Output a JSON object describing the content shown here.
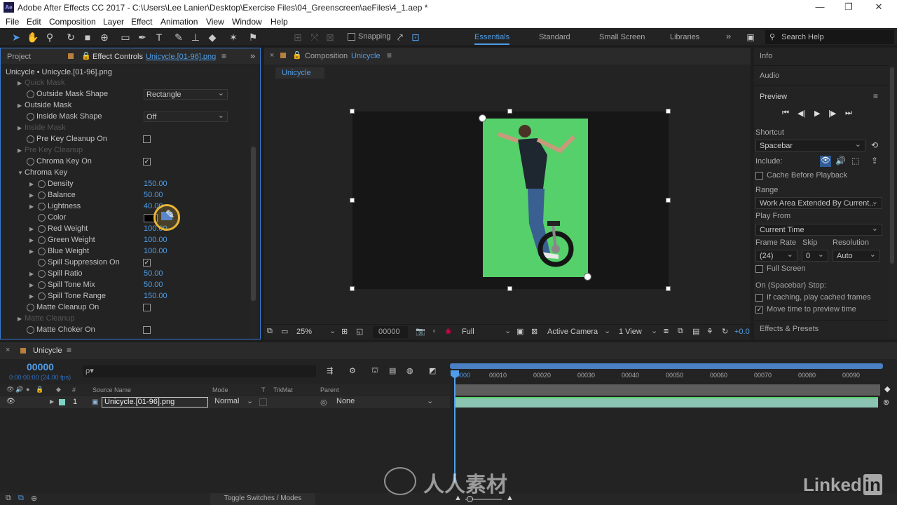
{
  "window": {
    "app_badge": "Ae",
    "title": "Adobe After Effects CC 2017 - C:\\Users\\Lee Lanier\\Desktop\\Exercise Files\\04_Greenscreen\\aeFiles\\4_1.aep *",
    "minimize": "—",
    "maximize": "❐",
    "close": "✕"
  },
  "menu": [
    "File",
    "Edit",
    "Composition",
    "Layer",
    "Effect",
    "Animation",
    "View",
    "Window",
    "Help"
  ],
  "toolbar": {
    "snapping_label": "Snapping",
    "workspaces": [
      "Essentials",
      "Standard",
      "Small Screen",
      "Libraries"
    ],
    "active_workspace": "Essentials",
    "more": "»",
    "search_placeholder": "Search Help"
  },
  "left_panel": {
    "tab_project": "Project",
    "tab_effect_controls": "Effect Controls",
    "tab_effect_controls_target": "Unicycle.[01-96].png",
    "header": "Unicycle • Unicycle.[01-96].png",
    "props": {
      "quick_mask": "Quick Mask",
      "outside_mask_shape": "Outside Mask Shape",
      "outside_mask_shape_val": "Rectangle",
      "outside_mask": "Outside Mask",
      "inside_mask_shape": "Inside Mask Shape",
      "inside_mask_shape_val": "Off",
      "inside_mask": "Inside Mask",
      "pre_key_cleanup_on": "Pre Key Cleanup On",
      "pre_key_cleanup": "Pre Key Cleanup",
      "chroma_key_on": "Chroma Key On",
      "chroma_key": "Chroma Key",
      "density": "Density",
      "density_val": "150.00",
      "balance": "Balance",
      "balance_val": "50.00",
      "lightness": "Lightness",
      "lightness_val": "40.00",
      "color": "Color",
      "red_weight": "Red Weight",
      "red_weight_val": "100.00",
      "green_weight": "Green Weight",
      "green_weight_val": "100.00",
      "blue_weight": "Blue Weight",
      "blue_weight_val": "100.00",
      "spill_suppression_on": "Spill Suppression On",
      "spill_ratio": "Spill Ratio",
      "spill_ratio_val": "50.00",
      "spill_tone_mix": "Spill Tone Mix",
      "spill_tone_mix_val": "50.00",
      "spill_tone_range": "Spill Tone Range",
      "spill_tone_range_val": "150.00",
      "matte_cleanup_on": "Matte Cleanup On",
      "matte_cleanup": "Matte Cleanup",
      "matte_choker_on": "Matte Choker On"
    }
  },
  "comp_panel": {
    "tab_prefix": "Composition",
    "tab_name": "Unicycle",
    "subtab": "Unicycle",
    "zoom": "25%",
    "timecode": "00000",
    "resolution": "Full",
    "camera": "Active Camera",
    "views": "1 View",
    "exposure": "+0.0"
  },
  "right_panel": {
    "info": "Info",
    "audio": "Audio",
    "preview": "Preview",
    "shortcut_label": "Shortcut",
    "shortcut_val": "Spacebar",
    "include_label": "Include:",
    "cache_before_playback": "Cache Before Playback",
    "range_label": "Range",
    "range_val": "Work Area Extended By Current...",
    "play_from_label": "Play From",
    "play_from_val": "Current Time",
    "frame_rate_label": "Frame Rate",
    "skip_label": "Skip",
    "resolution_label": "Resolution",
    "frame_rate_val": "(24)",
    "skip_val": "0",
    "resolution_val": "Auto",
    "full_screen": "Full Screen",
    "on_stop_label": "On (Spacebar) Stop:",
    "if_caching": "If caching, play cached frames",
    "move_time": "Move time to preview time",
    "effects_presets": "Effects & Presets"
  },
  "timeline": {
    "tab": "Unicycle",
    "timecode": "00000",
    "timecode_sub": "0:00:00:00 (24.00 fps)",
    "search_placeholder": "ρ▾",
    "col_hash": "#",
    "col_source_name": "Source Name",
    "col_mode": "Mode",
    "col_t": "T",
    "col_trkmat": "TrkMat",
    "col_parent": "Parent",
    "layer_num": "1",
    "layer_name": "Unicycle.[01-96].png",
    "layer_mode": "Normal",
    "layer_parent": "None",
    "ruler_start": "00000",
    "ticks": [
      "00010",
      "00020",
      "00030",
      "00040",
      "00050",
      "00060",
      "00070",
      "00080",
      "00090"
    ],
    "toggle": "Toggle Switches / Modes"
  },
  "watermark": {
    "text": "人人素材",
    "brand": "Linked",
    "brand_in": "in"
  },
  "colors": {
    "accent": "#4f9de8",
    "panel_border_active": "#3a7bd5",
    "greenscreen": "#55d06a",
    "layer_bar": "#8cc4b4"
  }
}
